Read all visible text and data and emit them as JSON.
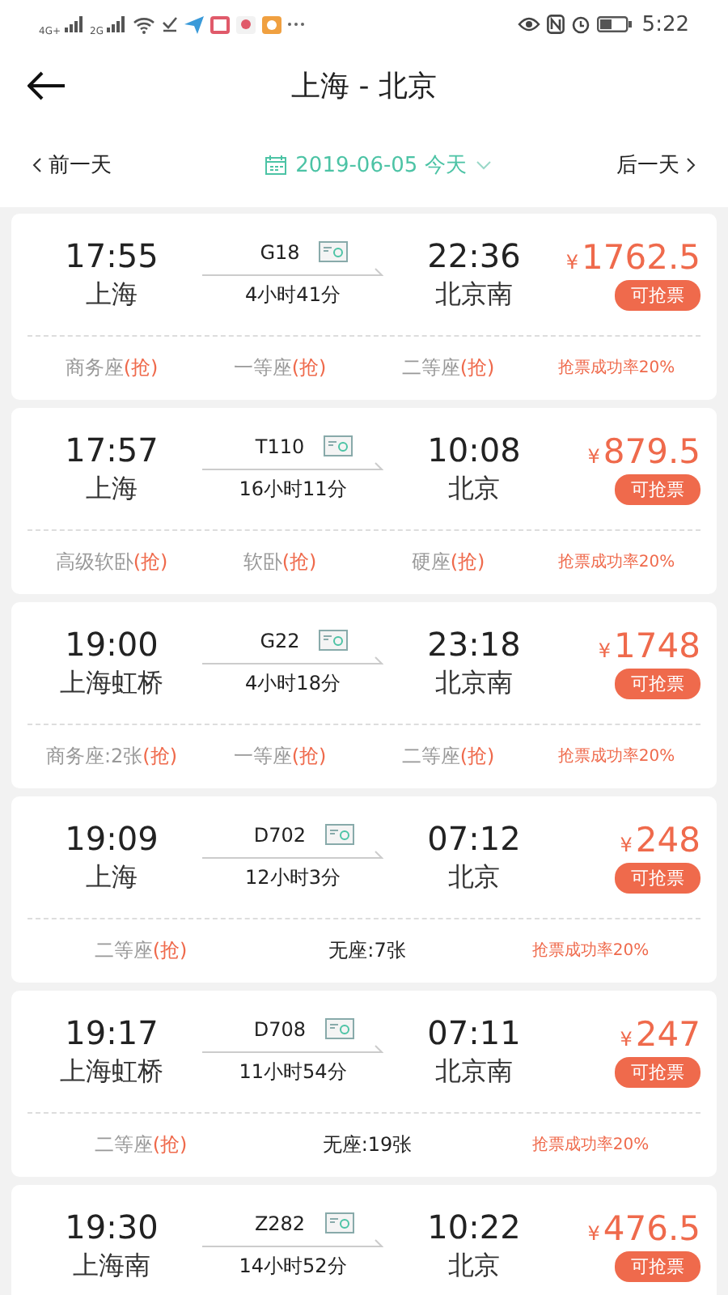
{
  "status_bar": {
    "network_labels": [
      "4G+",
      "2G"
    ],
    "time": "5:22"
  },
  "header": {
    "title": "上海 - 北京"
  },
  "date_bar": {
    "prev": "前一天",
    "date": "2019-06-05 今天",
    "next": "后一天"
  },
  "trains": [
    {
      "depart_time": "17:55",
      "depart_station": "上海",
      "number": "G18",
      "duration": "4小时41分",
      "arrive_time": "22:36",
      "arrive_station": "北京南",
      "currency": "¥",
      "price": "1762.5",
      "badge": "可抢票",
      "seats": [
        {
          "label": "商务座",
          "grab": "(抢)"
        },
        {
          "label": "一等座",
          "grab": "(抢)"
        },
        {
          "label": "二等座",
          "grab": "(抢)"
        }
      ],
      "rate": "抢票成功率20%"
    },
    {
      "depart_time": "17:57",
      "depart_station": "上海",
      "number": "T110",
      "duration": "16小时11分",
      "arrive_time": "10:08",
      "arrive_station": "北京",
      "currency": "¥",
      "price": "879.5",
      "badge": "可抢票",
      "seats": [
        {
          "label": "高级软卧",
          "grab": "(抢)"
        },
        {
          "label": "软卧",
          "grab": "(抢)"
        },
        {
          "label": "硬座",
          "grab": "(抢)"
        }
      ],
      "rate": "抢票成功率20%"
    },
    {
      "depart_time": "19:00",
      "depart_station": "上海虹桥",
      "number": "G22",
      "duration": "4小时18分",
      "arrive_time": "23:18",
      "arrive_station": "北京南",
      "currency": "¥",
      "price": "1748",
      "badge": "可抢票",
      "seats": [
        {
          "label": "商务座:2张",
          "grab": "(抢)"
        },
        {
          "label": "一等座",
          "grab": "(抢)"
        },
        {
          "label": "二等座",
          "grab": "(抢)"
        }
      ],
      "rate": "抢票成功率20%"
    },
    {
      "depart_time": "19:09",
      "depart_station": "上海",
      "number": "D702",
      "duration": "12小时3分",
      "arrive_time": "07:12",
      "arrive_station": "北京",
      "currency": "¥",
      "price": "248",
      "badge": "可抢票",
      "seats": [
        {
          "label": "二等座",
          "grab": "(抢)"
        },
        {
          "label": "无座:7张"
        }
      ],
      "rate": "抢票成功率20%"
    },
    {
      "depart_time": "19:17",
      "depart_station": "上海虹桥",
      "number": "D708",
      "duration": "11小时54分",
      "arrive_time": "07:11",
      "arrive_station": "北京南",
      "currency": "¥",
      "price": "247",
      "badge": "可抢票",
      "seats": [
        {
          "label": "二等座",
          "grab": "(抢)"
        },
        {
          "label": "无座:19张"
        }
      ],
      "rate": "抢票成功率20%"
    },
    {
      "depart_time": "19:30",
      "depart_station": "上海南",
      "number": "Z282",
      "duration": "14小时52分",
      "arrive_time": "10:22",
      "arrive_station": "北京",
      "currency": "¥",
      "price": "476.5",
      "badge": "可抢票"
    }
  ]
}
